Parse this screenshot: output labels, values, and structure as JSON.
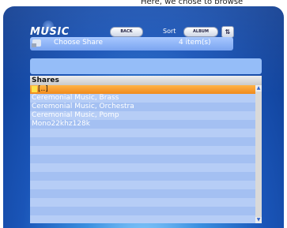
{
  "caption": "Here, we chose to browse",
  "app": {
    "logo": "MUSIC"
  },
  "toolbar": {
    "back_label": "BACK",
    "sort_label": "Sort",
    "sort_value": "ALBUM",
    "sort_toggle_label": "⇅"
  },
  "titlebar": {
    "title": "Choose Share",
    "count": "4 item(s)"
  },
  "list": {
    "header": "Shares",
    "items": [
      "[..]",
      "Ceremonial Music, Brass",
      "Ceremonial Music, Orchestra",
      "Ceremonial Music, Pomp",
      "Mono22khz128k"
    ],
    "selected_index": 0
  },
  "scrollbar": {
    "up": "▲",
    "down": "▼"
  }
}
